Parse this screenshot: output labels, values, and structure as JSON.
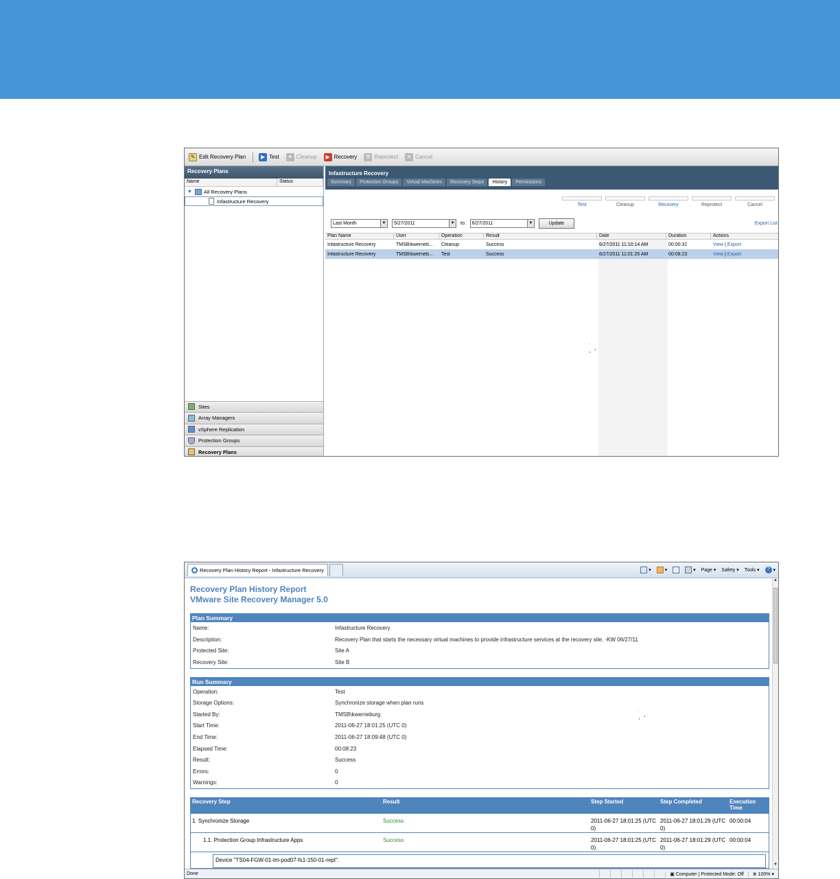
{
  "banner": {
    "color": "#4596d8"
  },
  "srm": {
    "toolbar": [
      {
        "label": "Edit Recovery Plan",
        "icon": "edit-icon",
        "enabled": true
      },
      {
        "label": "Test",
        "icon": "play-test-icon",
        "enabled": true
      },
      {
        "label": "Cleanup",
        "icon": "cleanup-icon",
        "enabled": false
      },
      {
        "label": "Recovery",
        "icon": "play-recovery-icon",
        "enabled": true
      },
      {
        "label": "Reprotect",
        "icon": "reprotect-icon",
        "enabled": false
      },
      {
        "label": "Cancel",
        "icon": "cancel-icon",
        "enabled": false
      }
    ],
    "left": {
      "title": "Recovery Plans",
      "col_name": "Name",
      "col_status": "Status",
      "tree_root": "All Recovery Plans",
      "tree_child": "Infastructure Recovery",
      "nav": [
        "Sites",
        "Array Managers",
        "vSphere Replication",
        "Protection Groups",
        "Recovery Plans"
      ]
    },
    "right": {
      "title": "Infastructure Recovery",
      "tabs": [
        "Summary",
        "Protection Groups",
        "Virtual Machines",
        "Recovery Steps",
        "History",
        "Permissions"
      ],
      "active_tab": "History",
      "ops": [
        "Test",
        "Cleanup",
        "Recovery",
        "Reprotect",
        "Cancel"
      ],
      "filter": {
        "range": "Last Month",
        "from": "5/27/2011",
        "to_label": "to:",
        "to": "6/27/2011",
        "update": "Update"
      },
      "export_list": "Export List",
      "columns": [
        "Plan Name",
        "User",
        "Operation",
        "Result",
        "Date",
        "Duration",
        "Actions"
      ],
      "rows": [
        {
          "plan": "Infastructure Recovery",
          "user": "TMSB\\kwerneb...",
          "op": "Cleanup",
          "result": "Success",
          "date": "6/27/2011 11:10:14 AM",
          "duration": "00:00:31",
          "view": "View",
          "sep": "|",
          "export": "Export"
        },
        {
          "plan": "Infastructure Recovery",
          "user": "TMSB\\kwerneb...",
          "op": "Test",
          "result": "Success",
          "date": "6/27/2011 11:01:25 AM",
          "duration": "00:08:23",
          "view": "View",
          "sep": "|",
          "export": "Export"
        }
      ]
    }
  },
  "ie": {
    "tab_title": "Recovery Plan History Report - Infastructure Recovery",
    "commands": [
      "Page ▾",
      "Safety ▾",
      "Tools ▾"
    ],
    "report_title_1": "Recovery Plan History Report",
    "report_title_2": "VMware Site Recovery Manager 5.0",
    "plan_summary": {
      "title": "Plan Summary",
      "rows": [
        {
          "k": "Name:",
          "v": "Infastructure Recovery"
        },
        {
          "k": "Description:",
          "v": "Recovery Plan that starts the necessary virtual machines to provide infrastructure services at the recovery site. -KW 06/27/11"
        },
        {
          "k": "Protected Site:",
          "v": "Site A"
        },
        {
          "k": "Recovery Site:",
          "v": "Site B"
        }
      ]
    },
    "run_summary": {
      "title": "Run Summary",
      "rows": [
        {
          "k": "Operation:",
          "v": "Test"
        },
        {
          "k": "Storage Options:",
          "v": "Synchronize storage when plan runs"
        },
        {
          "k": "Started By:",
          "v": "TMSB\\kwerneburg"
        },
        {
          "k": "Start Time:",
          "v": "2011-06-27 18:01:25 (UTC 0)"
        },
        {
          "k": "End Time:",
          "v": "2011-06-27 18:09:48 (UTC 0)"
        },
        {
          "k": "Elapsed Time:",
          "v": "00:08:23"
        },
        {
          "k": "Result:",
          "v": "Success"
        },
        {
          "k": "Errors:",
          "v": "0"
        },
        {
          "k": "Warnings:",
          "v": "0"
        }
      ]
    },
    "steps": {
      "headers": [
        "Recovery Step",
        "Result",
        "Step Started",
        "Step Completed",
        "Execution Time"
      ],
      "rows": [
        {
          "step": "1. Synchronize Storage",
          "result": "Success",
          "started": "2011-06-27 18:01:25 (UTC 0)",
          "completed": "2011-06-27 18:01:29 (UTC 0)",
          "exec": "00:00:04"
        },
        {
          "step": "1.1. Protection Group Infrastructure Apps",
          "result": "Success",
          "started": "2011-06-27 18:01:25 (UTC 0)",
          "completed": "2011-06-27 18:01:29 (UTC 0)",
          "exec": "00:00:04"
        }
      ],
      "device": "Device \"TS04-FGW-01-tm-pod07-fs1-150-01-repl\":"
    },
    "status": {
      "left": "Done",
      "zone": "Computer | Protected Mode: Off",
      "zoom": "100%"
    }
  }
}
